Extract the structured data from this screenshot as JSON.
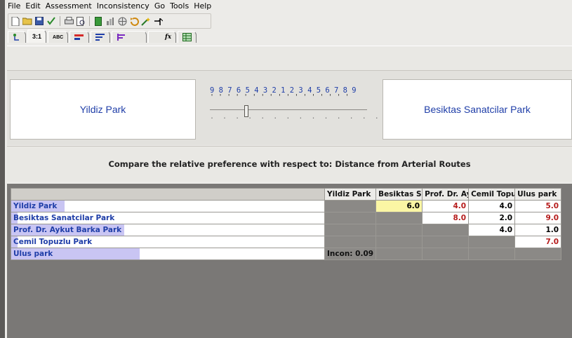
{
  "menu": [
    "File",
    "Edit",
    "Assessment",
    "Inconsistency",
    "Go",
    "Tools",
    "Help"
  ],
  "toolbar_icons": [
    "new-icon",
    "open-icon",
    "save-icon",
    "check-icon",
    "print-icon",
    "preview-icon",
    "model-icon",
    "chart-icon",
    "sensitivity-icon",
    "refresh-icon",
    "wand-icon",
    "arrow-icon"
  ],
  "tabs": [
    {
      "name": "tab-tree",
      "label": ""
    },
    {
      "name": "tab-numeric",
      "label": "3:1"
    },
    {
      "name": "tab-verbal",
      "label": "ABC"
    },
    {
      "name": "tab-graphic",
      "label": ""
    },
    {
      "name": "tab-bars",
      "label": ""
    },
    {
      "name": "tab-questionnaire",
      "label": ""
    },
    {
      "name": "tab-formula",
      "label": "fx"
    },
    {
      "name": "tab-matrix",
      "label": ""
    }
  ],
  "comparison": {
    "left_item": "Yildiz Park",
    "right_item": "Besiktas Sanatcilar Park",
    "scale_numbers": "9 8 7 6 5 4 3 2 1 2 3 4 5 6 7 8 9",
    "scale_ticks": "' ' ' ' ' ' ' ' ' ' ' ' ' ' ' ' '",
    "scale_dots": ".  .  .  .  .  .  .  .  .  .  .  .  .  .  .",
    "slider_value": 6
  },
  "prompt": "Compare the relative preference with respect to: Distance from Arterial Routes",
  "matrix": {
    "columns": [
      "Yildiz Park",
      "Besiktas S",
      "Prof. Dr. Ay",
      "Cemil Topu",
      "Ulus park"
    ],
    "rows": [
      {
        "label": "Yildiz Park",
        "highlight": 0.17,
        "cells": [
          "",
          "6.0",
          "4.0",
          "4.0",
          "5.0"
        ]
      },
      {
        "label": "Besiktas Sanatcilar Park",
        "highlight": 0.02,
        "cells": [
          "",
          "",
          "8.0",
          "2.0",
          "9.0"
        ]
      },
      {
        "label": "Prof. Dr. Aykut Barka Park",
        "highlight": 0.36,
        "cells": [
          "",
          "",
          "",
          "4.0",
          "1.0"
        ]
      },
      {
        "label": "Cemil Topuzlu Park",
        "highlight": 0.02,
        "cells": [
          "",
          "",
          "",
          "",
          "7.0"
        ]
      },
      {
        "label": "Ulus park",
        "highlight": 0.41,
        "cells": [
          "Incon: 0.09",
          "",
          "",
          "",
          ""
        ]
      }
    ]
  },
  "colors": {
    "item_text": "#1f3ea8",
    "red_value": "#b61c1c",
    "selected_cell": "#fbf6a4",
    "priority_bar": "#c9c5f3"
  }
}
